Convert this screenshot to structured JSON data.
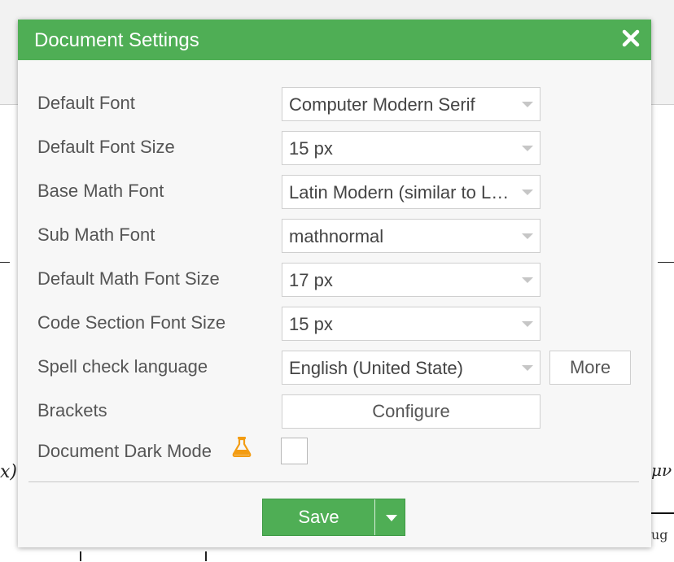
{
  "dialog": {
    "title": "Document Settings",
    "close_icon": "close-icon"
  },
  "settings": {
    "default_font": {
      "label": "Default Font",
      "value": "Computer Modern Serif"
    },
    "default_font_size": {
      "label": "Default Font Size",
      "value": "15 px"
    },
    "base_math_font": {
      "label": "Base Math Font",
      "value": "Latin Modern (similar to L…"
    },
    "sub_math_font": {
      "label": "Sub Math Font",
      "value": "mathnormal"
    },
    "default_math_font_size": {
      "label": "Default Math Font Size",
      "value": "17 px"
    },
    "code_section_font_size": {
      "label": "Code Section Font Size",
      "value": "15 px"
    },
    "spell_check_language": {
      "label": "Spell check language",
      "value": "English (United State)",
      "more_label": "More"
    },
    "brackets": {
      "label": "Brackets",
      "configure_label": "Configure"
    },
    "document_dark_mode": {
      "label": "Document Dark Mode",
      "icon": "flask-icon",
      "checked": false
    }
  },
  "footer": {
    "save_label": "Save"
  },
  "colors": {
    "header_green": "#4fae55",
    "flask_orange": "#f39c12"
  }
}
